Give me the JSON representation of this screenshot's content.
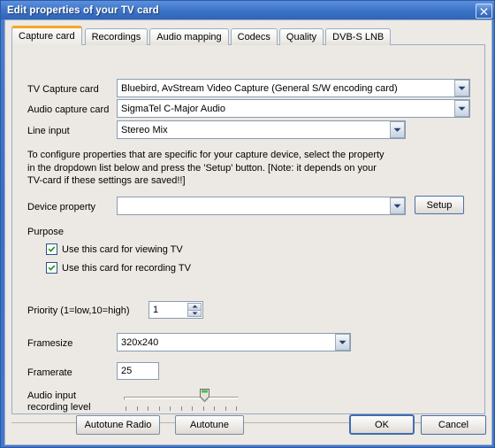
{
  "window": {
    "title": "Edit properties of your TV card",
    "close_label": "✖"
  },
  "tabs": [
    {
      "label": "Capture card",
      "active": true
    },
    {
      "label": "Recordings",
      "active": false
    },
    {
      "label": "Audio mapping",
      "active": false
    },
    {
      "label": "Codecs",
      "active": false
    },
    {
      "label": "Quality",
      "active": false
    },
    {
      "label": "DVB-S LNB",
      "active": false
    }
  ],
  "capture_card": {
    "tv_capture_card": {
      "label": "TV Capture card",
      "value": "Bluebird, AvStream Video Capture (General S/W encoding card)"
    },
    "audio_capture_card": {
      "label": "Audio capture card",
      "value": "SigmaTel C-Major Audio"
    },
    "line_input": {
      "label": "Line input",
      "value": "Stereo Mix"
    },
    "description": "To configure properties that are specific for your capture device, select the property\nin the dropdown list below and press the 'Setup' button. [Note: it depends on your\nTV-card if these settings are saved!!]",
    "device_property": {
      "label": "Device property",
      "value": "",
      "placeholder": ""
    },
    "setup_button": "Setup",
    "purpose": {
      "label": "Purpose",
      "items": [
        {
          "label": "Use this card for viewing TV",
          "checked": true
        },
        {
          "label": "Use this card for recording TV",
          "checked": true
        }
      ]
    },
    "priority": {
      "label": "Priority (1=low,10=high)",
      "value": "1"
    },
    "framesize": {
      "label": "Framesize",
      "value": "320x240"
    },
    "framerate": {
      "label": "Framerate",
      "value": "25"
    },
    "audio_level": {
      "label": "Audio input\nrecording level",
      "position_percent": 66,
      "tick_count": 11
    }
  },
  "footer": {
    "autotune_radio": "Autotune Radio",
    "autotune": "Autotune",
    "ok": "OK",
    "cancel": "Cancel"
  },
  "colors": {
    "titlebar_blue": "#3c74c8",
    "accent_tab": "#f5a623",
    "check_green": "#1a8f1a",
    "panel": "#ece9e4"
  }
}
